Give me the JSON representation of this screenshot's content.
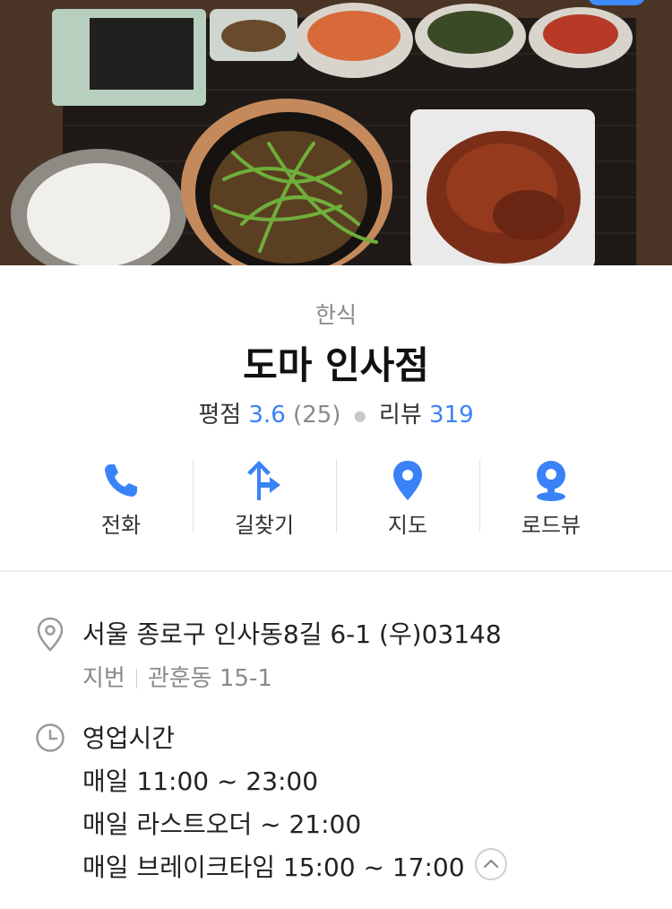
{
  "place": {
    "category": "한식",
    "name": "도마 인사점",
    "rating_label": "평점",
    "rating_value": "3.6",
    "rating_count": "(25)",
    "review_label": "리뷰",
    "review_count": "319"
  },
  "actions": [
    {
      "label": "전화",
      "icon": "phone-icon"
    },
    {
      "label": "길찾기",
      "icon": "directions-icon"
    },
    {
      "label": "지도",
      "icon": "map-pin-icon"
    },
    {
      "label": "로드뷰",
      "icon": "roadview-icon"
    }
  ],
  "address": {
    "main": "서울 종로구 인사동8길 6-1 (우)03148",
    "lot_label": "지번",
    "lot_value": "관훈동 15-1"
  },
  "hours": {
    "title": "영업시간",
    "lines": [
      "매일 11:00 ~ 23:00",
      "매일 라스트오더 ~ 21:00",
      "매일 브레이크타임 15:00 ~ 17:00"
    ]
  },
  "colors": {
    "accent": "#3a82f7",
    "muted_text": "#8a8a8a",
    "divider": "#e2e2e2"
  }
}
